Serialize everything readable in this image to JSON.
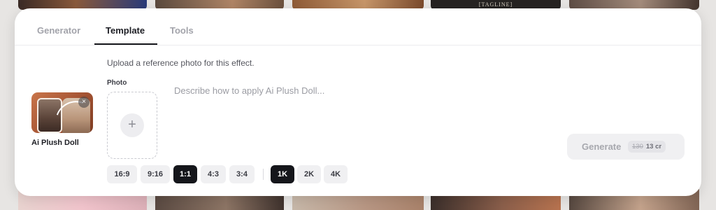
{
  "tabs": [
    {
      "label": "Generator",
      "active": false
    },
    {
      "label": "Template",
      "active": true
    },
    {
      "label": "Tools",
      "active": false
    }
  ],
  "upload_hint": "Upload a reference photo for this effect.",
  "template": {
    "name": "Ai Plush Doll",
    "remove_icon": "close-icon",
    "remove_glyph": "×"
  },
  "photo": {
    "label": "Photo",
    "add_icon": "plus-icon",
    "add_glyph": "+"
  },
  "prompt": {
    "value": "",
    "placeholder": "Describe how to apply Ai Plush Doll..."
  },
  "generate": {
    "label": "Generate",
    "original_cost": "130",
    "cost": "13 cr"
  },
  "aspect_ratios": [
    {
      "label": "16:9",
      "selected": false
    },
    {
      "label": "9:16",
      "selected": false
    },
    {
      "label": "1:1",
      "selected": true
    },
    {
      "label": "4:3",
      "selected": false
    },
    {
      "label": "3:4",
      "selected": false
    }
  ],
  "resolutions": [
    {
      "label": "1K",
      "selected": true
    },
    {
      "label": "2K",
      "selected": false
    },
    {
      "label": "4K",
      "selected": false
    }
  ],
  "background": {
    "tagline_text": "[TAGLINE]"
  },
  "colors": {
    "accent": "#15161b",
    "panel": "#ffffff",
    "muted_text": "#a2a3aa"
  }
}
